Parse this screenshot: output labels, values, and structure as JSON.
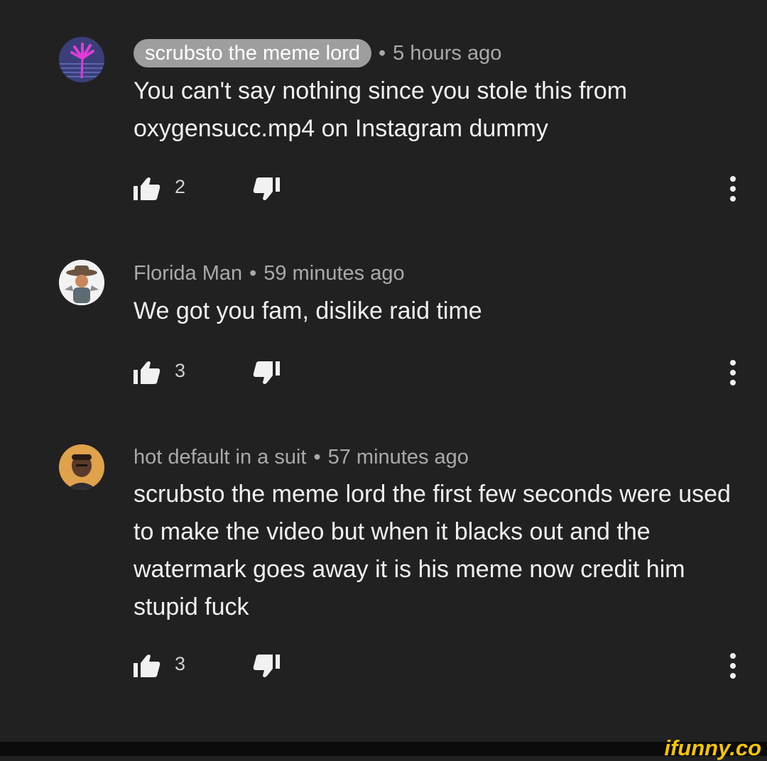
{
  "comments": [
    {
      "author": "scrubsto the meme lord",
      "time": "5 hours ago",
      "text": "You can't say nothing since you stole this from oxygensucc.mp4 on Instagram dummy",
      "likes": "2",
      "avatar_icon": "palm-tree-avatar-icon"
    },
    {
      "author": "Florida Man",
      "time": "59 minutes ago",
      "text": "We got you fam, dislike raid time",
      "likes": "3",
      "avatar_icon": "cowboy-avatar-icon"
    },
    {
      "author": "hot default in a suit",
      "time": "57 minutes ago",
      "text": "scrubsto the meme lord the first few seconds were used to make the video but when it blacks out and the watermark goes away it is his meme now credit him stupid fuck",
      "likes": "3",
      "avatar_icon": "man-in-suit-avatar-icon"
    }
  ],
  "separator": "•",
  "watermark": "ifunny.co",
  "colors": {
    "background": "#212121",
    "text": "#f1f1f1",
    "meta": "#aaaaaa",
    "chip": "#9e9e9e",
    "watermark": "#f6c500"
  }
}
